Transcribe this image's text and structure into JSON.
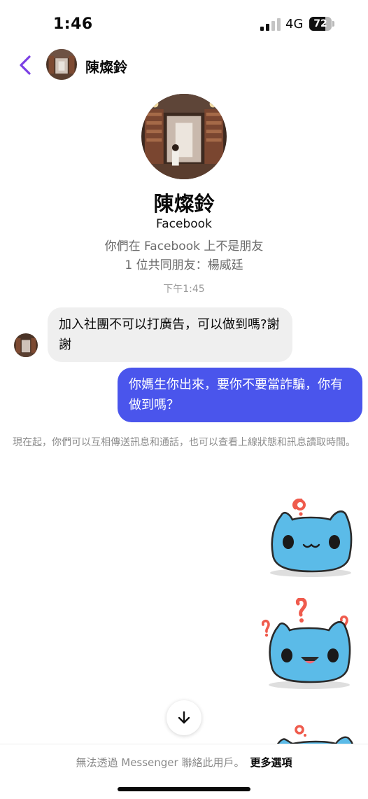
{
  "status_bar": {
    "time": "1:46",
    "network": "4G",
    "battery_text": "72",
    "battery_level": 0.72,
    "signal_bars_active": 2,
    "signal_bars_total": 4
  },
  "header": {
    "back_icon": "chevron-left-icon",
    "name": "陳燦鈴",
    "accent_color": "#7b3fe4"
  },
  "profile": {
    "name": "陳燦鈴",
    "platform": "Facebook",
    "relation": "你們在 Facebook 上不是朋友",
    "mutual_friends": "1 位共同朋友：楊威廷"
  },
  "conversation": {
    "timestamp": "下午1:45",
    "messages": [
      {
        "direction": "incoming",
        "text": "加入社團不可以打廣告，可以做到嗎?謝謝"
      },
      {
        "direction": "outgoing",
        "text": "你媽生你出來，要你不要當詐騙，你有做到嗎？"
      }
    ],
    "notice": "現在起，你們可以互相傳送訊息和通話，也可以查看上線狀態和訊息讀取時間。",
    "sticker_color": "#5bbbe8"
  },
  "scroll_button": {
    "icon": "arrow-down-icon"
  },
  "bottom_bar": {
    "message": "無法透過 Messenger 聯絡此用戶。",
    "link": "更多選項"
  },
  "colors": {
    "outgoing_bubble": "#4a55ec",
    "incoming_bubble": "#efefef"
  }
}
